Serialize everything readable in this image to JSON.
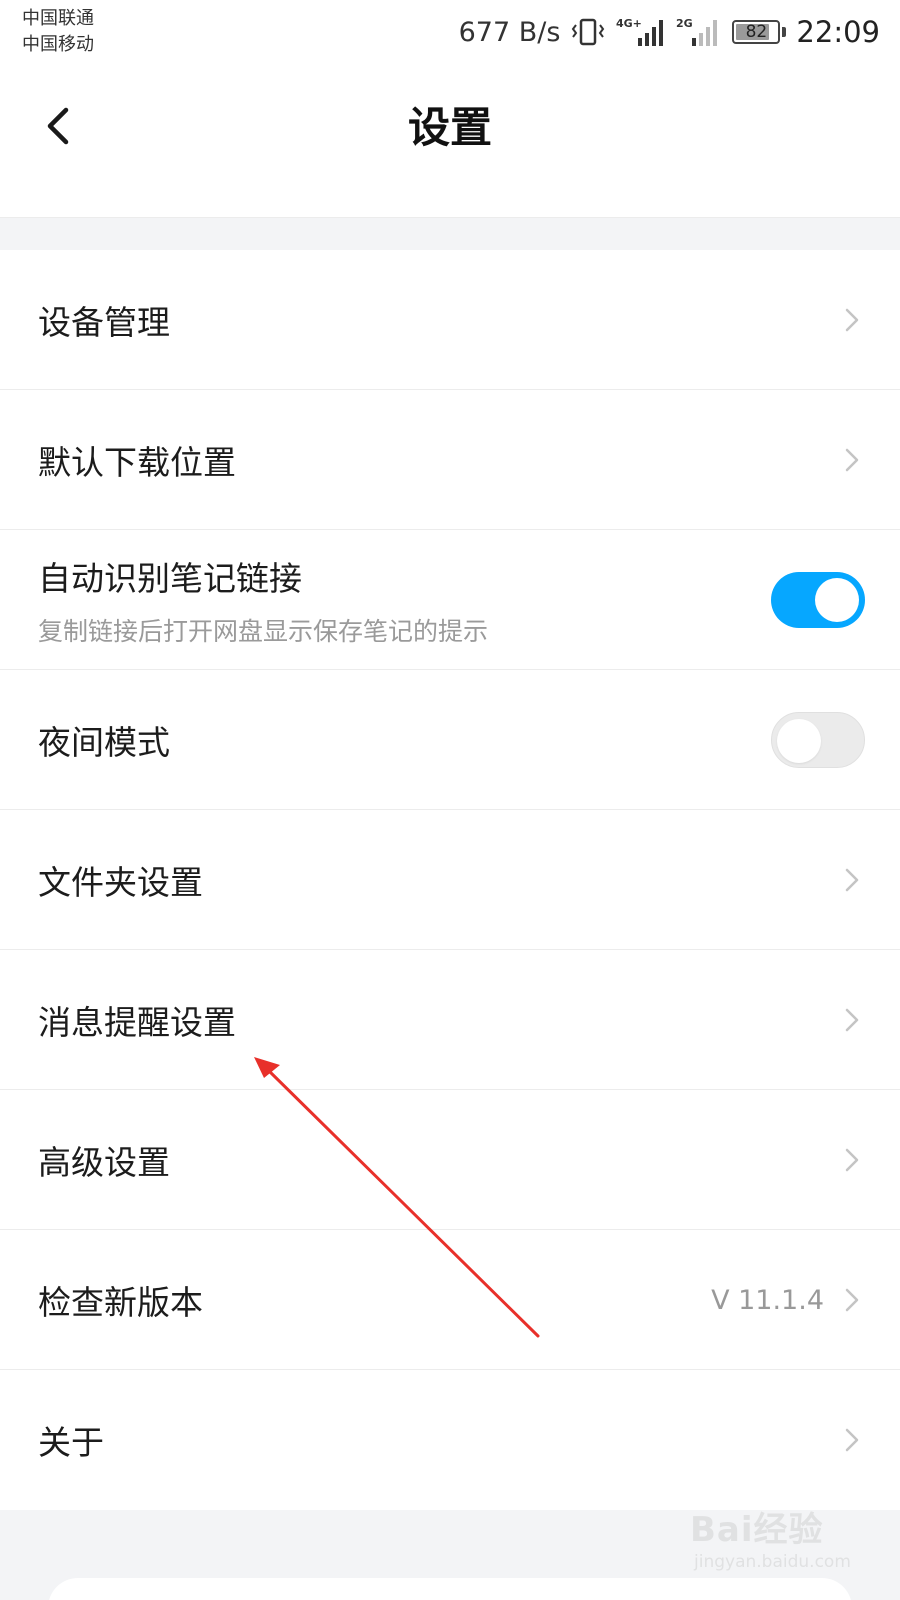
{
  "status_bar": {
    "carrier_1": "中国联通",
    "carrier_2": "中国移动",
    "net_speed": "677 B/s",
    "signal_1_type": "4G+",
    "signal_2_type": "2G",
    "battery": "82",
    "time": "22:09"
  },
  "header": {
    "title": "设置",
    "back_icon": "chevron-left-icon"
  },
  "settings": [
    {
      "label": "设备管理",
      "control": "chevron"
    },
    {
      "label": "默认下载位置",
      "control": "chevron"
    },
    {
      "label": "自动识别笔记链接",
      "sub": "复制链接后打开网盘显示保存笔记的提示",
      "control": "toggle",
      "on": true
    },
    {
      "label": "夜间模式",
      "control": "toggle",
      "on": false
    },
    {
      "label": "文件夹设置",
      "control": "chevron"
    },
    {
      "label": "消息提醒设置",
      "control": "chevron"
    },
    {
      "label": "高级设置",
      "control": "chevron"
    },
    {
      "label": "检查新版本",
      "value": "V 11.1.4",
      "control": "chevron"
    },
    {
      "label": "关于",
      "control": "chevron"
    }
  ],
  "watermark": {
    "main": "Bai经验",
    "sub": "jingyan.baidu.com"
  },
  "colors": {
    "accent": "#06a7ff",
    "annotation": "#e8302a",
    "divider": "#ececec",
    "band": "#f3f4f6"
  }
}
